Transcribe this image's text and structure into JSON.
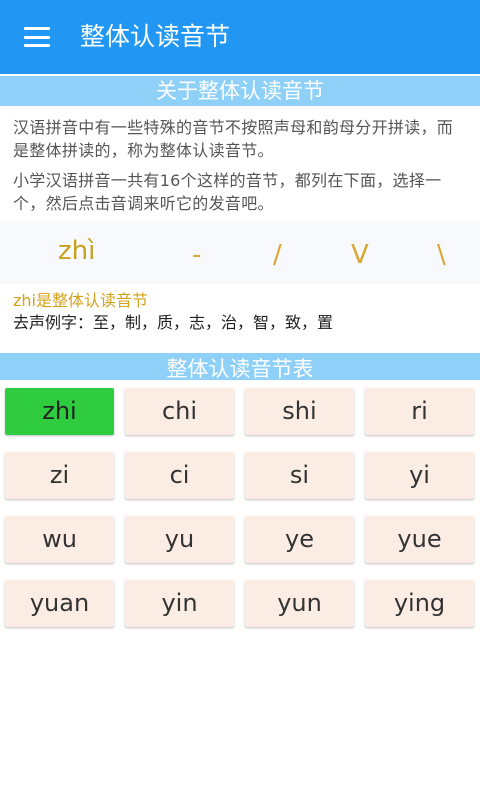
{
  "appbar": {
    "title": "整体认读音节"
  },
  "about": {
    "header": "关于整体认读音节",
    "paragraph1": "汉语拼音中有一些特殊的音节不按照声母和韵母分开拼读，而是整体拼读的，称为整体认读音节。",
    "paragraph2": "小学汉语拼音一共有16个这样的音节，都列在下面，选择一个，然后点击音调来听它的发音吧。"
  },
  "tones": {
    "display": "zhì",
    "marks": [
      "-",
      "/",
      "V",
      "\\"
    ]
  },
  "info": {
    "title": "zhi是整体认读音节",
    "examples": "去声例字：至，制，质，志，治，智，致，置"
  },
  "table": {
    "header": "整体认读音节表",
    "selected": "zhi",
    "syllables": [
      "zhi",
      "chi",
      "shi",
      "ri",
      "zi",
      "ci",
      "si",
      "yi",
      "wu",
      "yu",
      "ye",
      "yue",
      "yuan",
      "yin",
      "yun",
      "ying"
    ]
  },
  "colors": {
    "appbar": "#2196f3",
    "section_header": "#8fd0f8",
    "selected_cell": "#2fcc3f",
    "cell": "#fbede3",
    "accent_text": "#d4a21c"
  }
}
